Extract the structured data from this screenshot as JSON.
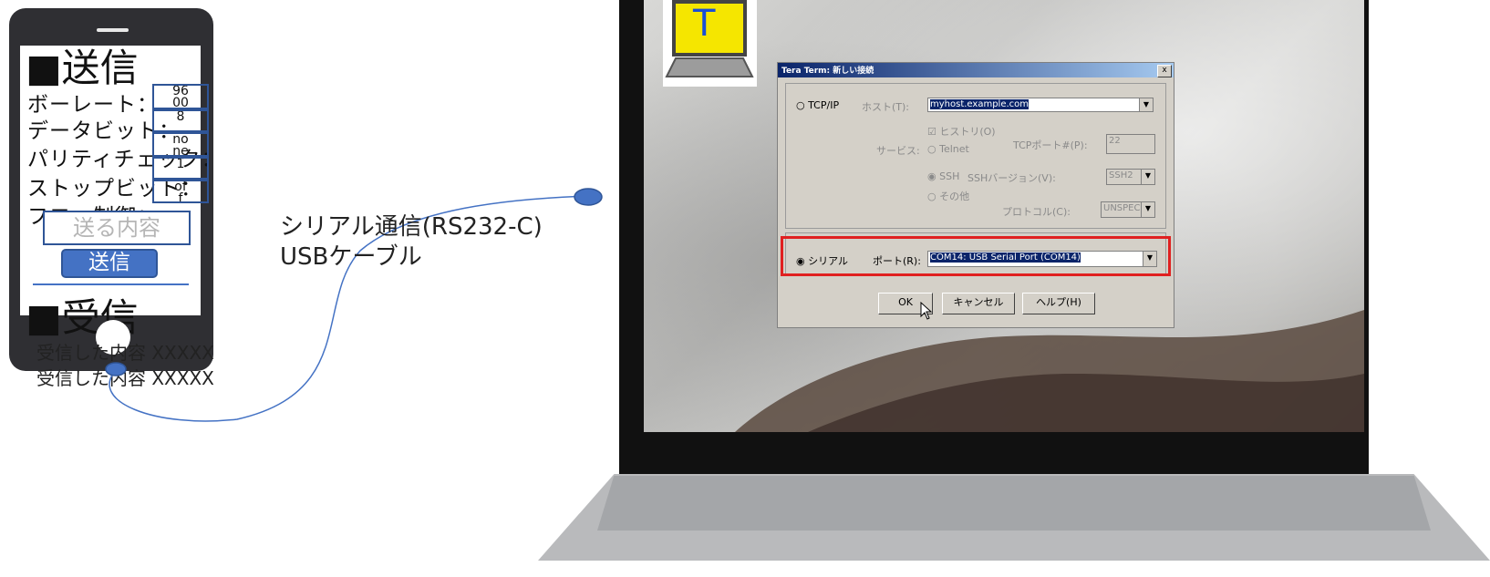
{
  "phone": {
    "send_title": "■送信",
    "rows": [
      {
        "label": "ボーレート：",
        "value": "96\n00"
      },
      {
        "label": "データビット：",
        "value": "8"
      },
      {
        "label": "パリティチェック：",
        "value": "no\nne"
      },
      {
        "label": "ストップビット：",
        "value": "1"
      },
      {
        "label": "フロー制御：",
        "value": "of\nf"
      }
    ],
    "send_placeholder": "送る内容",
    "send_button": "送信",
    "recv_title": "■受信",
    "recv_lines": [
      "受信した内容 XXXXX",
      "受信した内容 XXXXX"
    ]
  },
  "cable": {
    "line1": "シリアル通信(RS232-C)",
    "line2": "USBケーブル"
  },
  "app_icon": {
    "letter": "T"
  },
  "dialog": {
    "title": "Tera Term: 新しい接続",
    "close": "x",
    "tcpip_label": "TCP/IP",
    "host_label": "ホスト(T):",
    "host_value": "myhost.example.com",
    "history_label": "ヒストリ(O)",
    "service_label": "サービス:",
    "telnet_label": "Telnet",
    "tcpport_label": "TCPポート#(P):",
    "tcpport_value": "22",
    "ssh_label": "SSH",
    "sshver_label": "SSHバージョン(V):",
    "sshver_value": "SSH2",
    "other_label": "その他",
    "protocol_label": "プロトコル(C):",
    "protocol_value": "UNSPEC",
    "serial_label": "シリアル",
    "port_label": "ポート(R):",
    "port_value": "COM14: USB Serial Port (COM14)",
    "ok": "OK",
    "cancel": "キャンセル",
    "help": "ヘルプ(H)"
  },
  "colors": {
    "highlight_frame": "#e02020",
    "accent_blue": "#4472c4",
    "box_border": "#2f5597",
    "icon_yellow": "#f5e600"
  }
}
